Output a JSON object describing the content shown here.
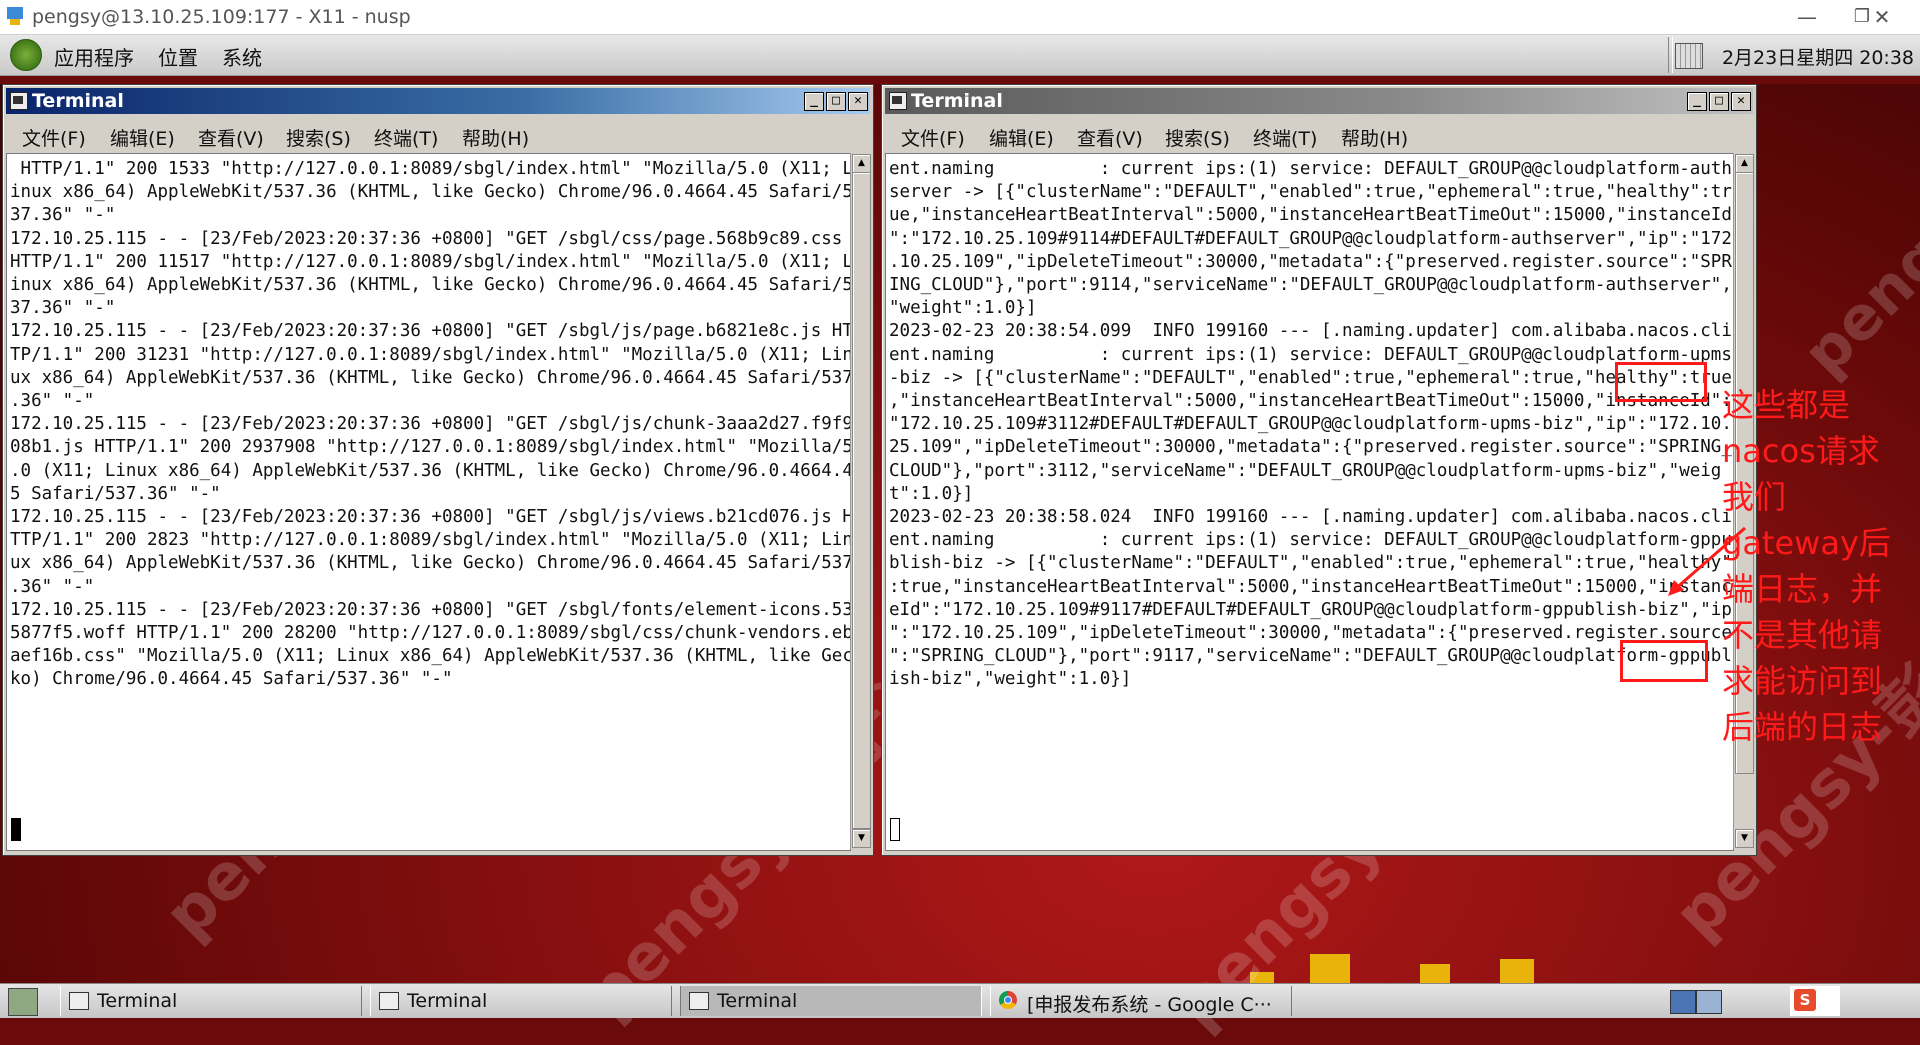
{
  "outer_window": {
    "title": "pengsy@13.10.25.109:177 - X11 - nusp",
    "minimize_icon": "minimize-icon",
    "restore_icon": "restore-icon",
    "close_icon": "close-icon"
  },
  "top_panel": {
    "menus": [
      "应用程序",
      "位置",
      "系统"
    ],
    "clock": "2月23日星期四 20:38"
  },
  "terminal_left": {
    "title": "Terminal",
    "menus": [
      "文件(F)",
      "编辑(E)",
      "查看(V)",
      "搜索(S)",
      "终端(T)",
      "帮助(H)"
    ],
    "lines": [
      " HTTP/1.1\" 200 1533 \"http://127.0.0.1:8089/sbgl/index.html\" \"Mozilla/5.0 (X11; L",
      "inux x86_64) AppleWebKit/537.36 (KHTML, like Gecko) Chrome/96.0.4664.45 Safari/5",
      "37.36\" \"-\"",
      "172.10.25.115 - - [23/Feb/2023:20:37:36 +0800] \"GET /sbgl/css/page.568b9c89.css",
      "HTTP/1.1\" 200 11517 \"http://127.0.0.1:8089/sbgl/index.html\" \"Mozilla/5.0 (X11; L",
      "inux x86_64) AppleWebKit/537.36 (KHTML, like Gecko) Chrome/96.0.4664.45 Safari/5",
      "37.36\" \"-\"",
      "172.10.25.115 - - [23/Feb/2023:20:37:36 +0800] \"GET /sbgl/js/page.b6821e8c.js HT",
      "TP/1.1\" 200 31231 \"http://127.0.0.1:8089/sbgl/index.html\" \"Mozilla/5.0 (X11; Lin",
      "ux x86_64) AppleWebKit/537.36 (KHTML, like Gecko) Chrome/96.0.4664.45 Safari/537",
      ".36\" \"-\"",
      "172.10.25.115 - - [23/Feb/2023:20:37:36 +0800] \"GET /sbgl/js/chunk-3aaa2d27.f9f9",
      "08b1.js HTTP/1.1\" 200 2937908 \"http://127.0.0.1:8089/sbgl/index.html\" \"Mozilla/5",
      ".0 (X11; Linux x86_64) AppleWebKit/537.36 (KHTML, like Gecko) Chrome/96.0.4664.4",
      "5 Safari/537.36\" \"-\"",
      "172.10.25.115 - - [23/Feb/2023:20:37:36 +0800] \"GET /sbgl/js/views.b21cd076.js H",
      "TTP/1.1\" 200 2823 \"http://127.0.0.1:8089/sbgl/index.html\" \"Mozilla/5.0 (X11; Lin",
      "ux x86_64) AppleWebKit/537.36 (KHTML, like Gecko) Chrome/96.0.4664.45 Safari/537",
      ".36\" \"-\"",
      "172.10.25.115 - - [23/Feb/2023:20:37:36 +0800] \"GET /sbgl/fonts/element-icons.53",
      "5877f5.woff HTTP/1.1\" 200 28200 \"http://127.0.0.1:8089/sbgl/css/chunk-vendors.eb",
      "aef16b.css\" \"Mozilla/5.0 (X11; Linux x86_64) AppleWebKit/537.36 (KHTML, like Gec",
      "ko) Chrome/96.0.4664.45 Safari/537.36\" \"-\""
    ]
  },
  "terminal_right": {
    "title": "Terminal",
    "menus": [
      "文件(F)",
      "编辑(E)",
      "查看(V)",
      "搜索(S)",
      "终端(T)",
      "帮助(H)"
    ],
    "lines": [
      "ent.naming          : current ips:(1) service: DEFAULT_GROUP@@cloudplatform-auth",
      "server -> [{\"clusterName\":\"DEFAULT\",\"enabled\":true,\"ephemeral\":true,\"healthy\":tr",
      "ue,\"instanceHeartBeatInterval\":5000,\"instanceHeartBeatTimeOut\":15000,\"instanceId",
      "\":\"172.10.25.109#9114#DEFAULT#DEFAULT_GROUP@@cloudplatform-authserver\",\"ip\":\"172",
      ".10.25.109\",\"ipDeleteTimeout\":30000,\"metadata\":{\"preserved.register.source\":\"SPR",
      "ING_CLOUD\"},\"port\":9114,\"serviceName\":\"DEFAULT_GROUP@@cloudplatform-authserver\",",
      "\"weight\":1.0}]",
      "2023-02-23 20:38:54.099  INFO 199160 --- [.naming.updater] com.alibaba.nacos.cli",
      "ent.naming          : current ips:(1) service: DEFAULT_GROUP@@cloudplatform-upms",
      "-biz -> [{\"clusterName\":\"DEFAULT\",\"enabled\":true,\"ephemeral\":true,\"healthy\":true",
      ",\"instanceHeartBeatInterval\":5000,\"instanceHeartBeatTimeOut\":15000,\"instanceId\":",
      "\"172.10.25.109#3112#DEFAULT#DEFAULT_GROUP@@cloudplatform-upms-biz\",\"ip\":\"172.10.",
      "25.109\",\"ipDeleteTimeout\":30000,\"metadata\":{\"preserved.register.source\":\"SPRING_",
      "CLOUD\"},\"port\":3112,\"serviceName\":\"DEFAULT_GROUP@@cloudplatform-upms-biz\",\"weig",
      "t\":1.0}]",
      "2023-02-23 20:38:58.024  INFO 199160 --- [.naming.updater] com.alibaba.nacos.cli",
      "ent.naming          : current ips:(1) service: DEFAULT_GROUP@@cloudplatform-gppu",
      "blish-biz -> [{\"clusterName\":\"DEFAULT\",\"enabled\":true,\"ephemeral\":true,\"healthy\"",
      ":true,\"instanceHeartBeatInterval\":5000,\"instanceHeartBeatTimeOut\":15000,\"instanc",
      "eId\":\"172.10.25.109#9117#DEFAULT#DEFAULT_GROUP@@cloudplatform-gppublish-biz\",\"ip",
      "\":\"172.10.25.109\",\"ipDeleteTimeout\":30000,\"metadata\":{\"preserved.register.source",
      "\":\"SPRING_CLOUD\"},\"port\":9117,\"serviceName\":\"DEFAULT_GROUP@@cloudplatform-gppubl",
      "ish-biz\",\"weight\":1.0}]"
    ]
  },
  "annotation": {
    "text_lines": [
      "这些都是",
      "nacos请求",
      "我们",
      "gateway后",
      "端日志，并",
      "不是其他请",
      "求能访问到",
      "后端的日志"
    ],
    "color": "#ff1a1a"
  },
  "watermark": "pengsy-彭上洋",
  "taskbar": {
    "tasks": [
      "Terminal",
      "Terminal",
      "Terminal",
      "[申报发布系统 - Google C···"
    ]
  },
  "colors": {
    "active_title": "#0a246a",
    "inactive_title": "#5a5a5a",
    "desktop": "#8a1010",
    "annotation_red": "#ff1a1a"
  }
}
